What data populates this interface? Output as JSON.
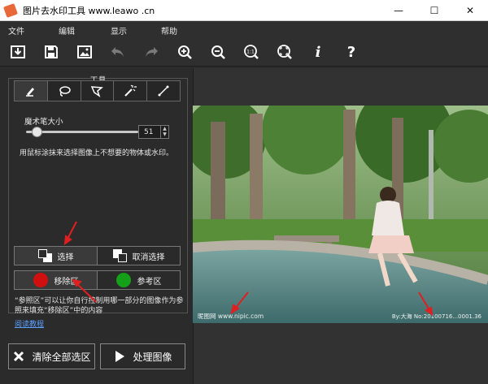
{
  "window": {
    "title": "图片去水印工具 www.leawo .cn",
    "controls": {
      "minimize": "—",
      "maximize": "☐",
      "close": "✕"
    }
  },
  "menu": {
    "items": [
      "文件",
      "编辑",
      "显示",
      "帮助"
    ]
  },
  "toolbar": {
    "icons": [
      "import-icon",
      "save-icon",
      "image-icon",
      "undo-icon",
      "redo-icon",
      "zoom-in-icon",
      "zoom-out-icon",
      "actual-size-icon",
      "fit-window-icon",
      "info-icon",
      "help-icon"
    ],
    "actual_size_label": "1:1",
    "info_label": "i",
    "help_label": "?"
  },
  "tools": {
    "group_label": "工具",
    "items": [
      "brush-icon",
      "lasso-icon",
      "polygon-lasso-icon",
      "magic-wand-icon",
      "line-icon"
    ],
    "brush_size_label": "魔术笔大小",
    "brush_size_value": "51",
    "brush_size_fraction": 0.1,
    "hint": "用鼠标涂抹来选择图像上不想要的物体或水印。"
  },
  "selection": {
    "select_label": "选择",
    "deselect_label": "取消选择"
  },
  "regions": {
    "remove_label": "移除区",
    "reference_label": "参考区",
    "remove_color": "#d01010",
    "reference_color": "#14a018"
  },
  "note": "“参照区”可以让你自行控制用哪一部分的图像作为参照来填充“移除区”中的内容",
  "tutorial_link": "阅读教程",
  "actions": {
    "clear_label": "清除全部选区",
    "process_label": "处理图像"
  },
  "photo": {
    "watermark_left": "昵图网 www.nipic.com",
    "watermark_right": "By:大海 No:20100716...0001.36"
  },
  "accent_colors": {
    "arrow": "#e02020",
    "link": "#5aa0ff"
  }
}
